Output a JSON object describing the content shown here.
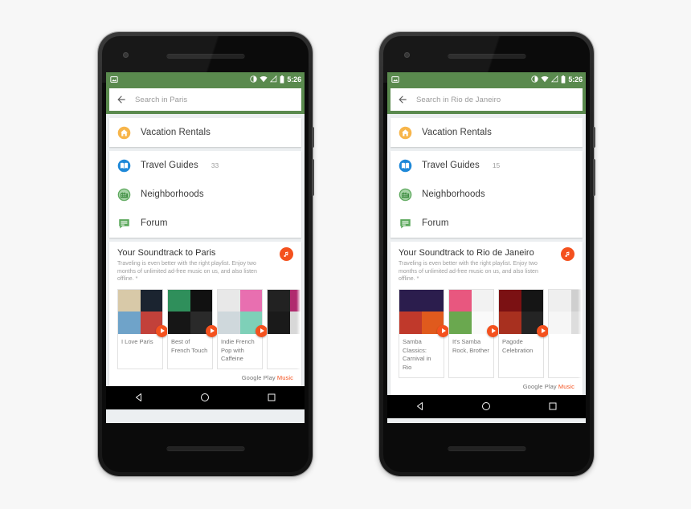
{
  "page": {
    "background": "#f7f7f7"
  },
  "theme": {
    "status_green": "#5a8a4e",
    "accent_orange": "#f4511e",
    "card_white": "#ffffff",
    "screen_bg": "#eceff1"
  },
  "phones": [
    {
      "id": "phone-paris",
      "statusbar": {
        "time": "5:26",
        "icons": [
          "screenshot-icon",
          "dnd-icon",
          "wifi-icon",
          "signal-icon",
          "battery-icon"
        ]
      },
      "search": {
        "placeholder": "Search in Paris",
        "back_icon": "back-arrow-icon"
      },
      "cards": [
        {
          "rows": [
            {
              "icon": "home-icon",
              "label": "Vacation Rentals",
              "count": ""
            }
          ]
        },
        {
          "rows": [
            {
              "icon": "book-icon",
              "label": "Travel Guides",
              "count": "33"
            },
            {
              "icon": "building-icon",
              "label": "Neighborhoods",
              "count": ""
            },
            {
              "icon": "forum-icon",
              "label": "Forum",
              "count": ""
            }
          ]
        }
      ],
      "music": {
        "title": "Your Soundtrack to Paris",
        "subtitle": "Traveling is even better with the right playlist. Enjoy two months of unlimited ad-free music on us, and also listen offline. *",
        "badge_icon": "music-note-icon",
        "albums": [
          {
            "title": "I Love Paris",
            "colors": [
              "#d8c9a8",
              "#1b2430",
              "#6fa3c9",
              "#c2413a"
            ]
          },
          {
            "title": "Best of French Touch",
            "colors": [
              "#2f8f5b",
              "#111111",
              "#161616",
              "#2a2a2a"
            ]
          },
          {
            "title": "Indie French Pop with Caffeine",
            "colors": [
              "#e8e8e8",
              "#e86fb0",
              "#cfd8dc",
              "#7ed0b8"
            ]
          },
          {
            "title": "",
            "colors": [
              "#222222",
              "#b02a6e",
              "#1a1a1a",
              "#d8d8d8"
            ]
          }
        ],
        "brand_prefix": "Google Play",
        "brand_suffix": "Music"
      },
      "nav": {
        "back": "nav-back-icon",
        "home": "nav-home-icon",
        "recents": "nav-recents-icon"
      }
    },
    {
      "id": "phone-rio",
      "statusbar": {
        "time": "5:26",
        "icons": [
          "screenshot-icon",
          "dnd-icon",
          "wifi-icon",
          "signal-icon",
          "battery-icon"
        ]
      },
      "search": {
        "placeholder": "Search in Rio de Janeiro",
        "back_icon": "back-arrow-icon"
      },
      "cards": [
        {
          "rows": [
            {
              "icon": "home-icon",
              "label": "Vacation Rentals",
              "count": ""
            }
          ]
        },
        {
          "rows": [
            {
              "icon": "book-icon",
              "label": "Travel Guides",
              "count": "15"
            },
            {
              "icon": "building-icon",
              "label": "Neighborhoods",
              "count": ""
            },
            {
              "icon": "forum-icon",
              "label": "Forum",
              "count": ""
            }
          ]
        }
      ],
      "music": {
        "title": "Your Soundtrack to Rio de Janeiro",
        "subtitle": "Traveling is even better with the right playlist. Enjoy two months of unlimited ad-free music on us, and also listen offline. *",
        "badge_icon": "music-note-icon",
        "albums": [
          {
            "title": "Samba Classics: Carnival in Rio",
            "colors": [
              "#2b1d4d",
              "#2b1d4d",
              "#c0392b",
              "#e05a1d"
            ]
          },
          {
            "title": "It's Samba Rock, Brother",
            "colors": [
              "#e8577f",
              "#f2f2f2",
              "#6aa84f",
              "#fafafa"
            ]
          },
          {
            "title": "Pagode Celebration",
            "colors": [
              "#7b1113",
              "#151515",
              "#a8301f",
              "#242424"
            ]
          },
          {
            "title": "",
            "colors": [
              "#efefef",
              "#cfcfcf",
              "#f6f6f6",
              "#dddddd"
            ]
          }
        ],
        "brand_prefix": "Google Play",
        "brand_suffix": "Music"
      },
      "nav": {
        "back": "nav-back-icon",
        "home": "nav-home-icon",
        "recents": "nav-recents-icon"
      }
    }
  ]
}
